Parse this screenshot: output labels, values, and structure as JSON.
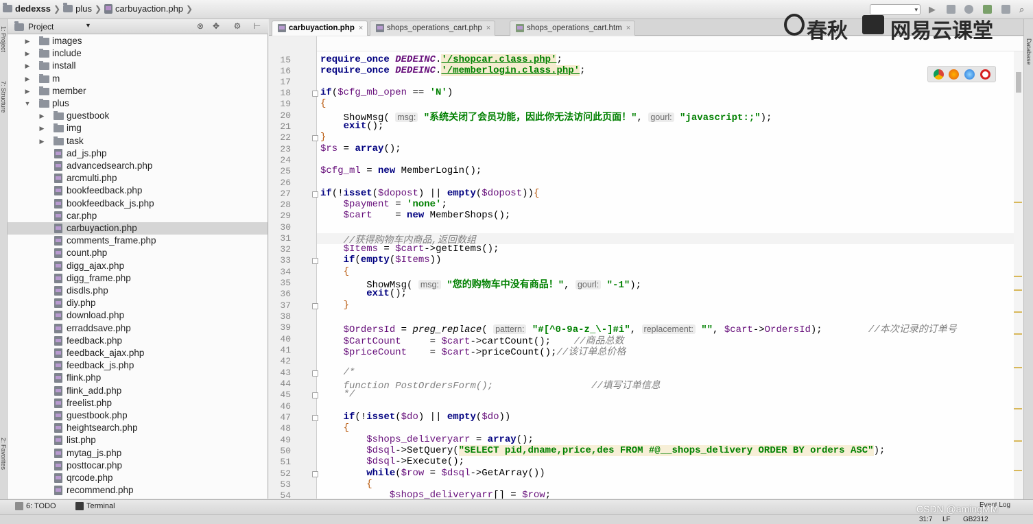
{
  "breadcrumb": {
    "project": "dedexss",
    "folder": "plus",
    "file": "carbuyaction.php"
  },
  "left_stripe": {
    "top_label": "1: Project",
    "mid_label": "7: Structure",
    "bottom_label": "2: Favorites"
  },
  "right_stripe": {
    "label": "Database"
  },
  "project_panel": {
    "title": "Project",
    "items": [
      {
        "label": "images",
        "type": "folder",
        "depth": 1,
        "expanded": false
      },
      {
        "label": "include",
        "type": "folder",
        "depth": 1,
        "expanded": false
      },
      {
        "label": "install",
        "type": "folder",
        "depth": 1,
        "expanded": false
      },
      {
        "label": "m",
        "type": "folder",
        "depth": 1,
        "expanded": false
      },
      {
        "label": "member",
        "type": "folder",
        "depth": 1,
        "expanded": false
      },
      {
        "label": "plus",
        "type": "folder",
        "depth": 1,
        "expanded": true
      },
      {
        "label": "guestbook",
        "type": "folder",
        "depth": 2,
        "expanded": false
      },
      {
        "label": "img",
        "type": "folder",
        "depth": 2,
        "expanded": false
      },
      {
        "label": "task",
        "type": "folder",
        "depth": 2,
        "expanded": false
      },
      {
        "label": "ad_js.php",
        "type": "file",
        "depth": 2
      },
      {
        "label": "advancedsearch.php",
        "type": "file",
        "depth": 2
      },
      {
        "label": "arcmulti.php",
        "type": "file",
        "depth": 2
      },
      {
        "label": "bookfeedback.php",
        "type": "file",
        "depth": 2
      },
      {
        "label": "bookfeedback_js.php",
        "type": "file",
        "depth": 2
      },
      {
        "label": "car.php",
        "type": "file",
        "depth": 2
      },
      {
        "label": "carbuyaction.php",
        "type": "file",
        "depth": 2,
        "selected": true
      },
      {
        "label": "comments_frame.php",
        "type": "file",
        "depth": 2
      },
      {
        "label": "count.php",
        "type": "file",
        "depth": 2
      },
      {
        "label": "digg_ajax.php",
        "type": "file",
        "depth": 2
      },
      {
        "label": "digg_frame.php",
        "type": "file",
        "depth": 2
      },
      {
        "label": "disdls.php",
        "type": "file",
        "depth": 2
      },
      {
        "label": "diy.php",
        "type": "file",
        "depth": 2
      },
      {
        "label": "download.php",
        "type": "file",
        "depth": 2
      },
      {
        "label": "erraddsave.php",
        "type": "file",
        "depth": 2
      },
      {
        "label": "feedback.php",
        "type": "file",
        "depth": 2
      },
      {
        "label": "feedback_ajax.php",
        "type": "file",
        "depth": 2
      },
      {
        "label": "feedback_js.php",
        "type": "file",
        "depth": 2
      },
      {
        "label": "flink.php",
        "type": "file",
        "depth": 2
      },
      {
        "label": "flink_add.php",
        "type": "file",
        "depth": 2
      },
      {
        "label": "freelist.php",
        "type": "file",
        "depth": 2
      },
      {
        "label": "guestbook.php",
        "type": "file",
        "depth": 2
      },
      {
        "label": "heightsearch.php",
        "type": "file",
        "depth": 2
      },
      {
        "label": "list.php",
        "type": "file",
        "depth": 2
      },
      {
        "label": "mytag_js.php",
        "type": "file",
        "depth": 2
      },
      {
        "label": "posttocar.php",
        "type": "file",
        "depth": 2
      },
      {
        "label": "qrcode.php",
        "type": "file",
        "depth": 2
      },
      {
        "label": "recommend.php",
        "type": "file",
        "depth": 2
      }
    ]
  },
  "tabs": [
    {
      "label": "carbuyaction.php",
      "active": true
    },
    {
      "label": "shops_operations_cart.php",
      "active": false
    },
    {
      "label": "shops_operations_cart.htm",
      "active": false
    }
  ],
  "watermark": {
    "left": "春秋",
    "right": "网易云课堂"
  },
  "editor": {
    "line_numbers": [
      "15",
      "16",
      "17",
      "18",
      "19",
      "20",
      "21",
      "22",
      "23",
      "24",
      "25",
      "26",
      "27",
      "28",
      "29",
      "30",
      "31",
      "32",
      "33",
      "34",
      "35",
      "36",
      "37",
      "38",
      "39",
      "40",
      "41",
      "42",
      "43",
      "44",
      "45",
      "46",
      "47",
      "48",
      "49",
      "50",
      "51",
      "52",
      "53",
      "54"
    ],
    "current_line": "31",
    "hints": {
      "msg": "msg:",
      "gourl": "gourl:",
      "pattern": "pattern:",
      "replacement": "replacement:"
    },
    "strings": {
      "shopcar": "'/shopcar.class.php'",
      "memberlogin": "'/memberlogin.class.php'",
      "n": "'N'",
      "close_msg": "\"系统关闭了会员功能，因此你无法访问此页面！\"",
      "js_url": "\"javascript:;\"",
      "none": "'none'",
      "empty_cart": "\"您的购物车中没有商品！\"",
      "minus_one": "\"-1\"",
      "regex": "\"#[^0-9a-z_\\-]#i\"",
      "empty_str": "\"\"",
      "sql": "\"SELECT pid,dname,price,des FROM #@__shops_delivery ORDER BY orders ASC\""
    },
    "comments": {
      "get_items": "//获得购物车内商品,返回数组",
      "order_id": "//本次记录的订单号",
      "goods_total": "//商品总数",
      "order_price": "//该订单总价格",
      "fill_form": "//填写订单信息",
      "open": "/*",
      "close": "*/"
    }
  },
  "bottom_tabs": [
    {
      "label": "6: TODO"
    },
    {
      "label": "Terminal"
    }
  ],
  "status": {
    "event_log": "Event Log",
    "position": "31:7",
    "line_sep": "LF",
    "encoding": "GB2312",
    "credit": "CSDN @amingMM"
  }
}
